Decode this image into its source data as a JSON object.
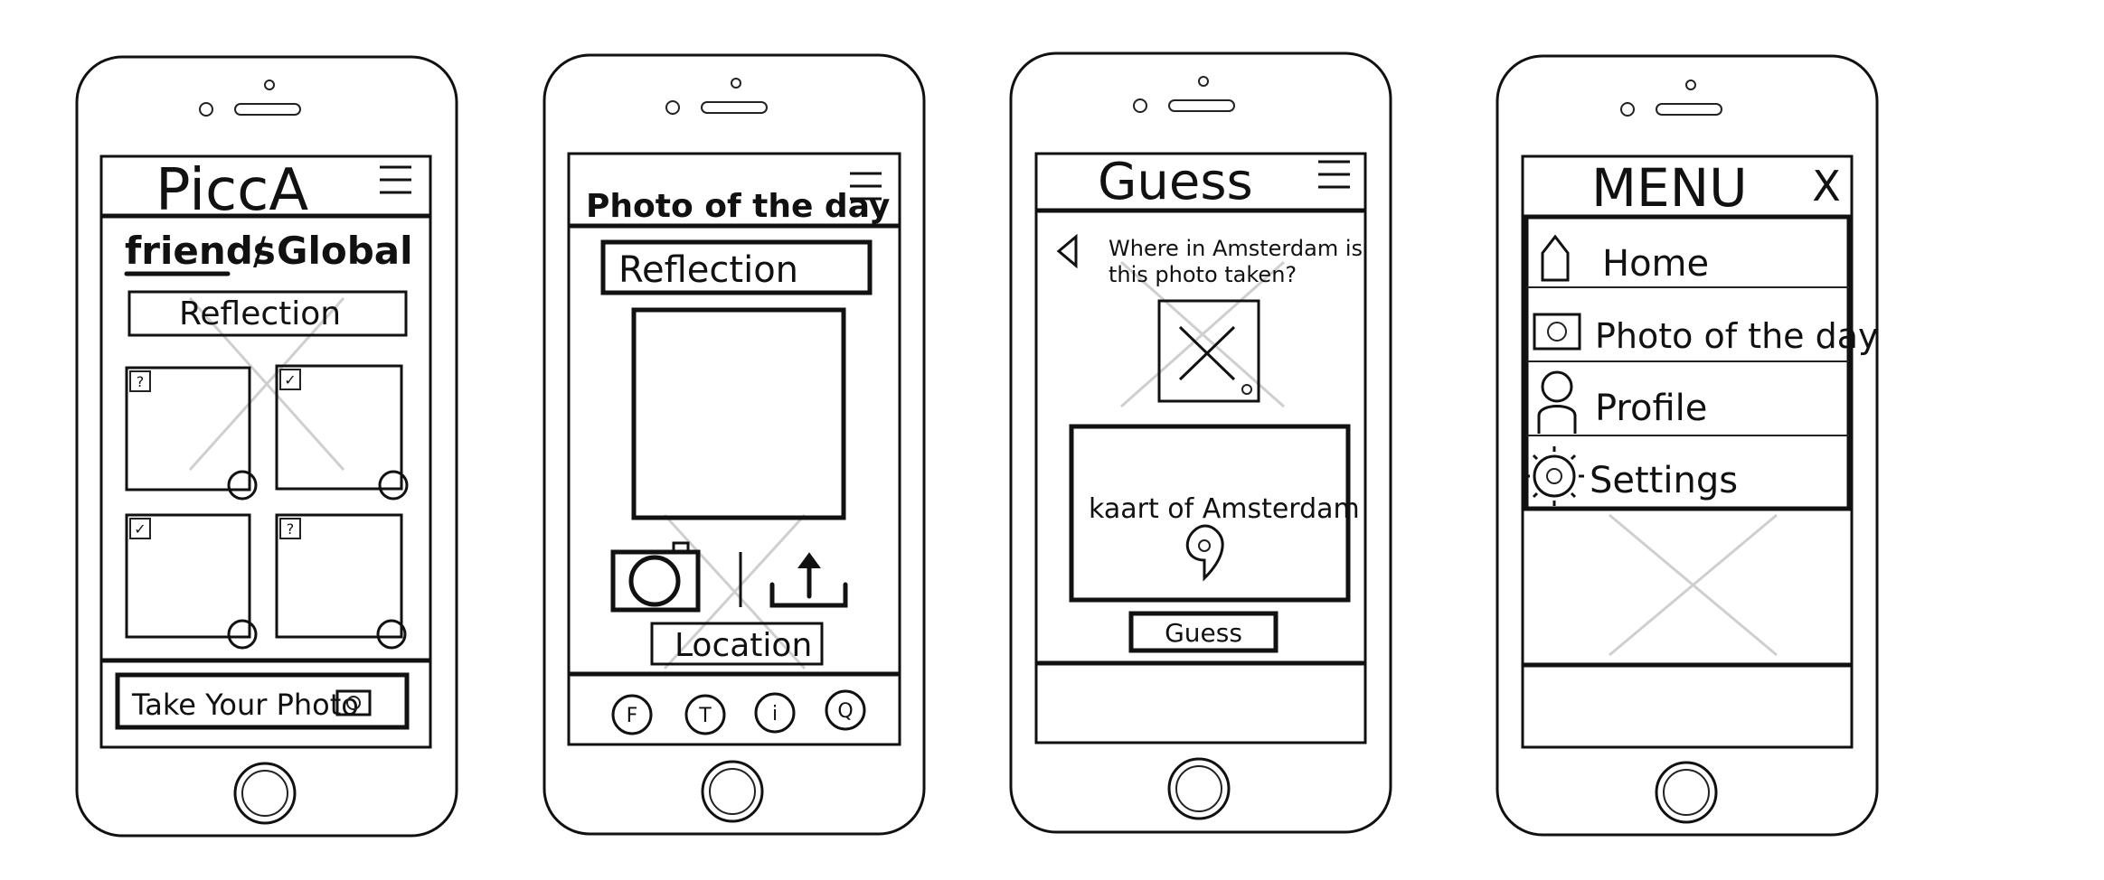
{
  "home": {
    "title": "PiccA",
    "tab_friends": "friends",
    "tab_separator": "/",
    "tab_global": "Global",
    "topic": "Reflection",
    "tiles": [
      "?",
      "✓",
      "✓",
      "?"
    ],
    "take_photo": "Take Your Photo"
  },
  "photo_day": {
    "title": "Photo of the day",
    "topic": "Reflection",
    "location": "Location",
    "share_icons": [
      "F",
      "T",
      "i",
      "Q"
    ]
  },
  "guess": {
    "title": "Guess",
    "question_line1": "Where in Amsterdam is",
    "question_line2": "this photo taken?",
    "map_label": "kaart of Amsterdam",
    "guess_button": "Guess"
  },
  "menu": {
    "title": "MENU",
    "close": "X",
    "items": [
      "Home",
      "Photo of the day",
      "Profile",
      "Settings"
    ]
  }
}
